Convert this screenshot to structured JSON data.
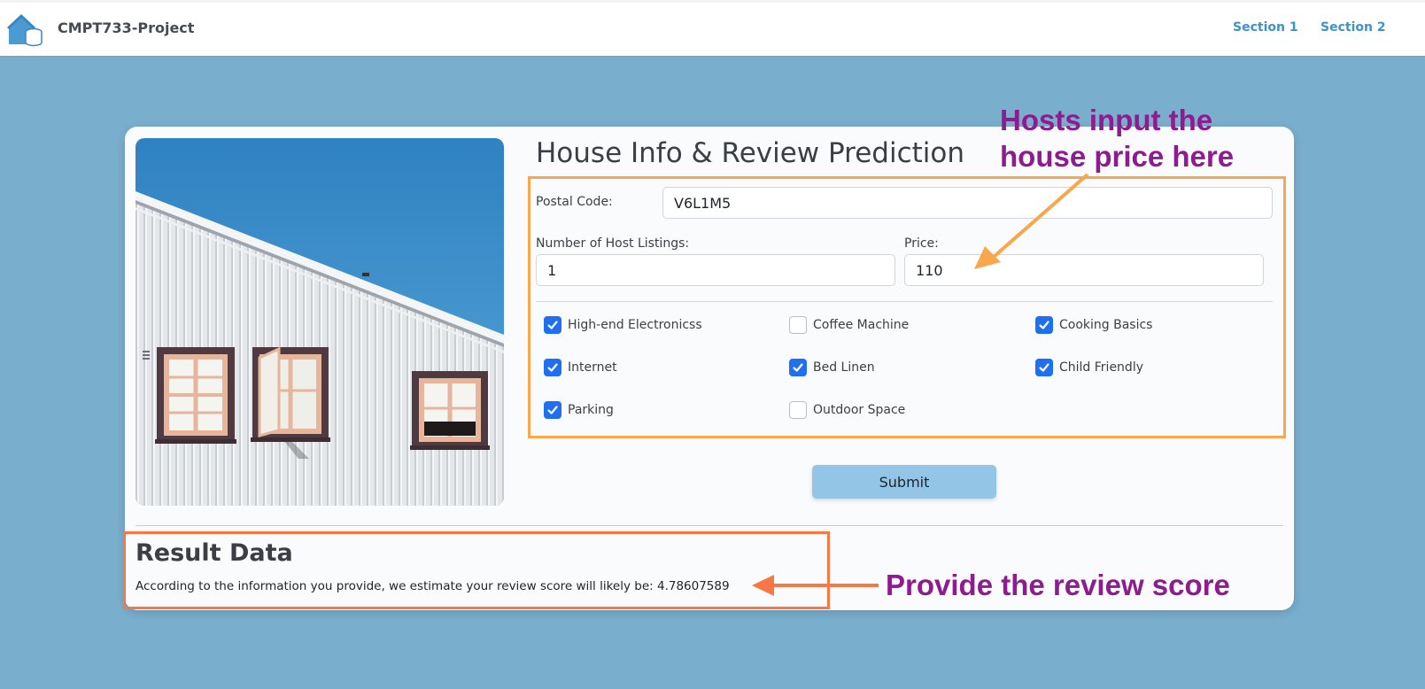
{
  "header": {
    "brand_name": "CMPT733-Project",
    "logo_icon": "house-coins-icon",
    "nav": [
      {
        "label": "Section 1"
      },
      {
        "label": "Section 2"
      }
    ]
  },
  "form": {
    "title": "House Info & Review Prediction",
    "postal_code": {
      "label": "Postal Code:",
      "value": "V6L1M5"
    },
    "host_listings": {
      "label": "Number of Host Listings:",
      "value": "1"
    },
    "price": {
      "label": "Price:",
      "value": "110"
    },
    "amenities": [
      {
        "label": "High-end Electronicss",
        "checked": true
      },
      {
        "label": "Coffee Machine",
        "checked": false
      },
      {
        "label": "Cooking Basics",
        "checked": true
      },
      {
        "label": "Internet",
        "checked": true
      },
      {
        "label": "Bed Linen",
        "checked": true
      },
      {
        "label": "Child Friendly",
        "checked": true
      },
      {
        "label": "Parking",
        "checked": true
      },
      {
        "label": "Outdoor Space",
        "checked": false
      }
    ],
    "submit_label": "Submit"
  },
  "result": {
    "title": "Result Data",
    "text": "According to the information you provide, we estimate your review score will likely be: 4.78607589"
  },
  "annotations": {
    "price_note_line1": "Hosts input the",
    "price_note_line2": "house price here",
    "score_note": "Provide the review score"
  },
  "colors": {
    "page_background": "#7aaecd",
    "accent_link": "#3d93c7",
    "checkbox_on": "#1f6ff0",
    "submit_button": "#93c5e7",
    "highlight_form_box": "#f9a64d",
    "highlight_result_box": "#f77845",
    "annotation_text": "#8e1b8f"
  }
}
